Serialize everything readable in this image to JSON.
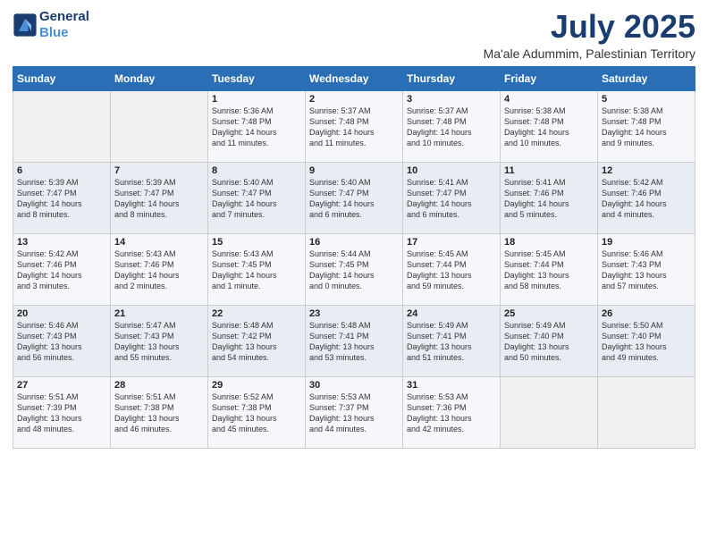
{
  "header": {
    "logo_line1": "General",
    "logo_line2": "Blue",
    "month": "July 2025",
    "location": "Ma'ale Adummim, Palestinian Territory"
  },
  "days_of_week": [
    "Sunday",
    "Monday",
    "Tuesday",
    "Wednesday",
    "Thursday",
    "Friday",
    "Saturday"
  ],
  "weeks": [
    [
      {
        "day": "",
        "info": ""
      },
      {
        "day": "",
        "info": ""
      },
      {
        "day": "1",
        "info": "Sunrise: 5:36 AM\nSunset: 7:48 PM\nDaylight: 14 hours\nand 11 minutes."
      },
      {
        "day": "2",
        "info": "Sunrise: 5:37 AM\nSunset: 7:48 PM\nDaylight: 14 hours\nand 11 minutes."
      },
      {
        "day": "3",
        "info": "Sunrise: 5:37 AM\nSunset: 7:48 PM\nDaylight: 14 hours\nand 10 minutes."
      },
      {
        "day": "4",
        "info": "Sunrise: 5:38 AM\nSunset: 7:48 PM\nDaylight: 14 hours\nand 10 minutes."
      },
      {
        "day": "5",
        "info": "Sunrise: 5:38 AM\nSunset: 7:48 PM\nDaylight: 14 hours\nand 9 minutes."
      }
    ],
    [
      {
        "day": "6",
        "info": "Sunrise: 5:39 AM\nSunset: 7:47 PM\nDaylight: 14 hours\nand 8 minutes."
      },
      {
        "day": "7",
        "info": "Sunrise: 5:39 AM\nSunset: 7:47 PM\nDaylight: 14 hours\nand 8 minutes."
      },
      {
        "day": "8",
        "info": "Sunrise: 5:40 AM\nSunset: 7:47 PM\nDaylight: 14 hours\nand 7 minutes."
      },
      {
        "day": "9",
        "info": "Sunrise: 5:40 AM\nSunset: 7:47 PM\nDaylight: 14 hours\nand 6 minutes."
      },
      {
        "day": "10",
        "info": "Sunrise: 5:41 AM\nSunset: 7:47 PM\nDaylight: 14 hours\nand 6 minutes."
      },
      {
        "day": "11",
        "info": "Sunrise: 5:41 AM\nSunset: 7:46 PM\nDaylight: 14 hours\nand 5 minutes."
      },
      {
        "day": "12",
        "info": "Sunrise: 5:42 AM\nSunset: 7:46 PM\nDaylight: 14 hours\nand 4 minutes."
      }
    ],
    [
      {
        "day": "13",
        "info": "Sunrise: 5:42 AM\nSunset: 7:46 PM\nDaylight: 14 hours\nand 3 minutes."
      },
      {
        "day": "14",
        "info": "Sunrise: 5:43 AM\nSunset: 7:46 PM\nDaylight: 14 hours\nand 2 minutes."
      },
      {
        "day": "15",
        "info": "Sunrise: 5:43 AM\nSunset: 7:45 PM\nDaylight: 14 hours\nand 1 minute."
      },
      {
        "day": "16",
        "info": "Sunrise: 5:44 AM\nSunset: 7:45 PM\nDaylight: 14 hours\nand 0 minutes."
      },
      {
        "day": "17",
        "info": "Sunrise: 5:45 AM\nSunset: 7:44 PM\nDaylight: 13 hours\nand 59 minutes."
      },
      {
        "day": "18",
        "info": "Sunrise: 5:45 AM\nSunset: 7:44 PM\nDaylight: 13 hours\nand 58 minutes."
      },
      {
        "day": "19",
        "info": "Sunrise: 5:46 AM\nSunset: 7:43 PM\nDaylight: 13 hours\nand 57 minutes."
      }
    ],
    [
      {
        "day": "20",
        "info": "Sunrise: 5:46 AM\nSunset: 7:43 PM\nDaylight: 13 hours\nand 56 minutes."
      },
      {
        "day": "21",
        "info": "Sunrise: 5:47 AM\nSunset: 7:43 PM\nDaylight: 13 hours\nand 55 minutes."
      },
      {
        "day": "22",
        "info": "Sunrise: 5:48 AM\nSunset: 7:42 PM\nDaylight: 13 hours\nand 54 minutes."
      },
      {
        "day": "23",
        "info": "Sunrise: 5:48 AM\nSunset: 7:41 PM\nDaylight: 13 hours\nand 53 minutes."
      },
      {
        "day": "24",
        "info": "Sunrise: 5:49 AM\nSunset: 7:41 PM\nDaylight: 13 hours\nand 51 minutes."
      },
      {
        "day": "25",
        "info": "Sunrise: 5:49 AM\nSunset: 7:40 PM\nDaylight: 13 hours\nand 50 minutes."
      },
      {
        "day": "26",
        "info": "Sunrise: 5:50 AM\nSunset: 7:40 PM\nDaylight: 13 hours\nand 49 minutes."
      }
    ],
    [
      {
        "day": "27",
        "info": "Sunrise: 5:51 AM\nSunset: 7:39 PM\nDaylight: 13 hours\nand 48 minutes."
      },
      {
        "day": "28",
        "info": "Sunrise: 5:51 AM\nSunset: 7:38 PM\nDaylight: 13 hours\nand 46 minutes."
      },
      {
        "day": "29",
        "info": "Sunrise: 5:52 AM\nSunset: 7:38 PM\nDaylight: 13 hours\nand 45 minutes."
      },
      {
        "day": "30",
        "info": "Sunrise: 5:53 AM\nSunset: 7:37 PM\nDaylight: 13 hours\nand 44 minutes."
      },
      {
        "day": "31",
        "info": "Sunrise: 5:53 AM\nSunset: 7:36 PM\nDaylight: 13 hours\nand 42 minutes."
      },
      {
        "day": "",
        "info": ""
      },
      {
        "day": "",
        "info": ""
      }
    ]
  ]
}
